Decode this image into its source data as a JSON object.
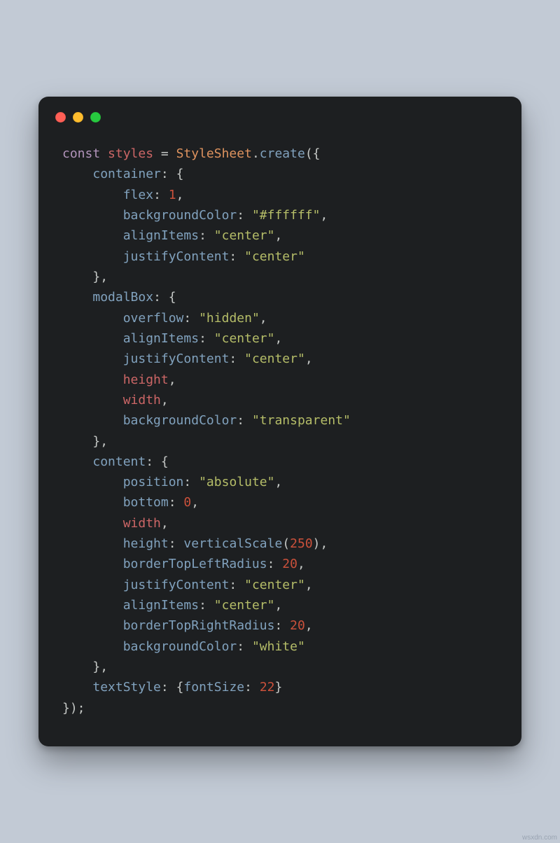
{
  "titlebar": {
    "buttons": [
      "close",
      "minimize",
      "zoom"
    ]
  },
  "watermark": "wsxdn.com",
  "code": {
    "l0": {
      "kw": "const",
      "var": "styles",
      "eq": " = ",
      "ty": "StyleSheet",
      "dot": ".",
      "fn": "create",
      "open": "({"
    },
    "l1": {
      "key": "container",
      "suf": ": {"
    },
    "l2": {
      "key": "flex",
      "sep": ": ",
      "val_num": "1",
      "comma": ","
    },
    "l3": {
      "key": "backgroundColor",
      "sep": ": ",
      "val_str": "\"#ffffff\"",
      "comma": ","
    },
    "l4": {
      "key": "alignItems",
      "sep": ": ",
      "val_str": "\"center\"",
      "comma": ","
    },
    "l5": {
      "key": "justifyContent",
      "sep": ": ",
      "val_str": "\"center\""
    },
    "l6": {
      "close": "},"
    },
    "l7": {
      "key": "modalBox",
      "suf": ": {"
    },
    "l8": {
      "key": "overflow",
      "sep": ": ",
      "val_str": "\"hidden\"",
      "comma": ","
    },
    "l9": {
      "key": "alignItems",
      "sep": ": ",
      "val_str": "\"center\"",
      "comma": ","
    },
    "l10": {
      "key": "justifyContent",
      "sep": ": ",
      "val_str": "\"center\"",
      "comma": ","
    },
    "l11": {
      "ident": "height",
      "comma": ","
    },
    "l12": {
      "ident": "width",
      "comma": ","
    },
    "l13": {
      "key": "backgroundColor",
      "sep": ": ",
      "val_str": "\"transparent\""
    },
    "l14": {
      "close": "},"
    },
    "l15": {
      "key": "content",
      "suf": ": {"
    },
    "l16": {
      "key": "position",
      "sep": ": ",
      "val_str": "\"absolute\"",
      "comma": ","
    },
    "l17": {
      "key": "bottom",
      "sep": ": ",
      "val_num": "0",
      "comma": ","
    },
    "l18": {
      "ident": "width",
      "comma": ","
    },
    "l19": {
      "key": "height",
      "sep": ": ",
      "fn": "verticalScale",
      "open": "(",
      "arg_num": "250",
      "close": ")",
      "comma": ","
    },
    "l20": {
      "key": "borderTopLeftRadius",
      "sep": ": ",
      "val_num": "20",
      "comma": ","
    },
    "l21": {
      "key": "justifyContent",
      "sep": ": ",
      "val_str": "\"center\"",
      "comma": ","
    },
    "l22": {
      "key": "alignItems",
      "sep": ": ",
      "val_str": "\"center\"",
      "comma": ","
    },
    "l23": {
      "key": "borderTopRightRadius",
      "sep": ": ",
      "val_num": "20",
      "comma": ","
    },
    "l24": {
      "key": "backgroundColor",
      "sep": ": ",
      "val_str": "\"white\""
    },
    "l25": {
      "close": "},"
    },
    "l26": {
      "key": "textStyle",
      "suf": ": {",
      "k2": "fontSize",
      "sep": ": ",
      "val_num": "22",
      "close": "}"
    },
    "l27": {
      "close": "});"
    }
  }
}
